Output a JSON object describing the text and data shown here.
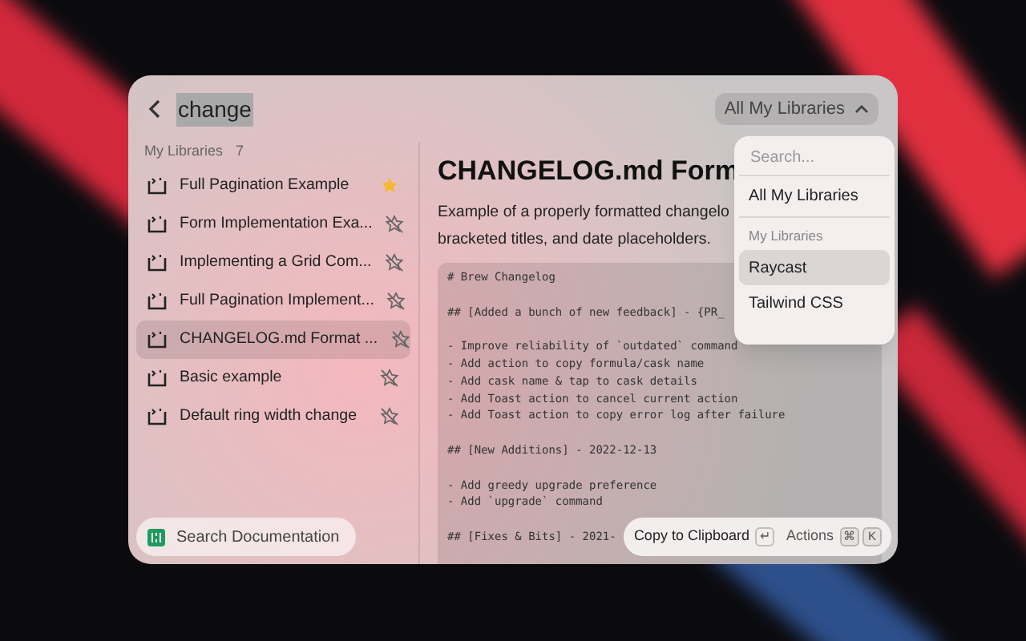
{
  "search": {
    "value": "change"
  },
  "library_filter": {
    "label": "All My Libraries",
    "expanded": true
  },
  "sidebar": {
    "section": "My Libraries",
    "count": "7",
    "items": [
      {
        "label": "Full Pagination Example",
        "favorite": true,
        "selected": false
      },
      {
        "label": "Form Implementation Exa...",
        "favorite": false,
        "selected": false
      },
      {
        "label": "Implementing a Grid Com...",
        "favorite": false,
        "selected": false
      },
      {
        "label": "Full Pagination Implement...",
        "favorite": false,
        "selected": false
      },
      {
        "label": "CHANGELOG.md Format ...",
        "favorite": false,
        "selected": true
      },
      {
        "label": "Basic example",
        "favorite": false,
        "selected": false
      },
      {
        "label": "Default ring width change",
        "favorite": false,
        "selected": false
      }
    ]
  },
  "detail": {
    "title": "CHANGELOG.md Form",
    "description": [
      "Example of a properly formatted changelo",
      "bracketed titles, and date placeholders."
    ],
    "code": [
      [
        "# Brew Changelog"
      ],
      [
        "## [Added a bunch of new feedback] - {PR_"
      ],
      [
        "- Improve reliability of `outdated` command",
        "- Add action to copy formula/cask name",
        "- Add cask name & tap to cask details",
        "- Add Toast action to cancel current action",
        "- Add Toast action to copy error log after failure"
      ],
      [
        "## [New Additions] - 2022-12-13"
      ],
      [
        "- Add greedy upgrade preference",
        "- Add `upgrade` command"
      ],
      [
        "## [Fixes & Bits] - 2021-"
      ]
    ]
  },
  "dropdown": {
    "placeholder": "Search...",
    "top_option": "All My Libraries",
    "section": "My Libraries",
    "options": [
      {
        "label": "Raycast",
        "selected": true
      },
      {
        "label": "Tailwind CSS",
        "selected": false
      }
    ]
  },
  "footer": {
    "left_button": "Search Documentation",
    "primary_action": "Copy to Clipboard",
    "primary_key": "↵",
    "actions": "Actions",
    "action_keys": [
      "⌘",
      "K"
    ]
  }
}
